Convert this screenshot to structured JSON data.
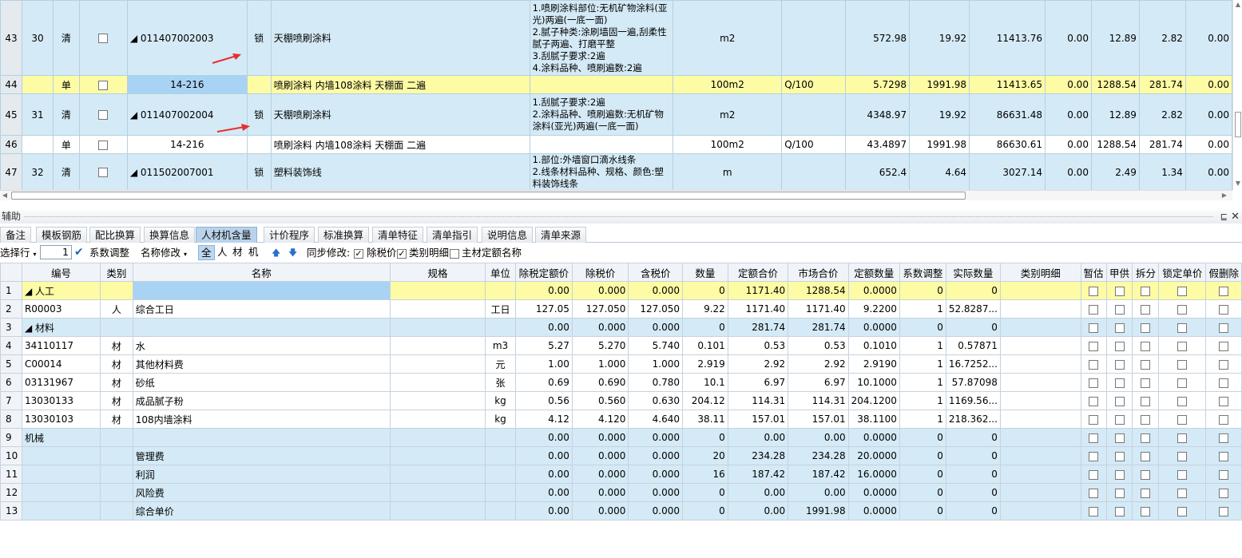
{
  "top_grid": {
    "rows": [
      {
        "rownum": "43",
        "seq": "30",
        "type": "清",
        "code": "◢ 011407002003",
        "lock": "锁",
        "name": "天棚喷刷涂料",
        "desc": "1.喷刷涂料部位:无机矿物涂料(亚光)两遍(一底一面)\n2.腻子种类:涂刷墙固一遍,刮柔性腻子两遍、打磨平整\n3.刮腻子要求:2遍\n4.涂料品种、喷刷遍数:2遍",
        "unit": "m2",
        "expr": "",
        "qty": "572.98",
        "price": "19.92",
        "total": "11413.76",
        "c1": "0.00",
        "c2": "12.89",
        "c3": "2.82",
        "c4": "0.00"
      },
      {
        "rownum": "44",
        "seq": "",
        "type": "单",
        "code": "14-216",
        "lock": "",
        "name": "喷刷涂料 内墙108涂料 天棚面 二遍",
        "desc": "",
        "unit": "100m2",
        "expr": "Q/100",
        "qty": "5.7298",
        "price": "1991.98",
        "total": "11413.65",
        "c1": "0.00",
        "c2": "1288.54",
        "c3": "281.74",
        "c4": "0.00"
      },
      {
        "rownum": "45",
        "seq": "31",
        "type": "清",
        "code": "◢ 011407002004",
        "lock": "锁",
        "name": "天棚喷刷涂料",
        "desc": "1.刮腻子要求:2遍\n2.涂料品种、喷刷遍数:无机矿物涂料(亚光)两遍(一底一面)",
        "unit": "m2",
        "expr": "",
        "qty": "4348.97",
        "price": "19.92",
        "total": "86631.48",
        "c1": "0.00",
        "c2": "12.89",
        "c3": "2.82",
        "c4": "0.00"
      },
      {
        "rownum": "46",
        "seq": "",
        "type": "单",
        "code": "14-216",
        "lock": "",
        "name": "喷刷涂料 内墙108涂料 天棚面 二遍",
        "desc": "",
        "unit": "100m2",
        "expr": "Q/100",
        "qty": "43.4897",
        "price": "1991.98",
        "total": "86630.61",
        "c1": "0.00",
        "c2": "1288.54",
        "c3": "281.74",
        "c4": "0.00"
      },
      {
        "rownum": "47",
        "seq": "32",
        "type": "清",
        "code": "◢ 011502007001",
        "lock": "锁",
        "name": "塑料装饰线",
        "desc": "1.部位:外墙窗口滴水线条\n2.线条材料品种、规格、颜色:塑料装饰线条",
        "unit": "m",
        "expr": "",
        "qty": "652.4",
        "price": "4.64",
        "total": "3027.14",
        "c1": "0.00",
        "c2": "2.49",
        "c3": "1.34",
        "c4": "0.00"
      }
    ]
  },
  "panel": {
    "title": "辅助",
    "pin": "⊑",
    "close": "✕"
  },
  "tabs": [
    "备注",
    "模板钢筋",
    "配比换算",
    "换算信息",
    "人材机含量",
    "计价程序",
    "标准换算",
    "清单特征",
    "清单指引",
    "说明信息",
    "清单来源"
  ],
  "active_tab": "人材机含量",
  "toolbar": {
    "select_row": "选择行",
    "spin_value": "1",
    "coef_adjust": "系数调整",
    "name_edit": "名称修改",
    "filters": [
      "全",
      "人",
      "材",
      "机"
    ],
    "sync_label": "同步修改:",
    "opt1": "除税价",
    "opt2": "类别明细",
    "opt3": "主材定额名称"
  },
  "bottom_grid": {
    "headers": [
      "编号",
      "类别",
      "名称",
      "规格",
      "单位",
      "除税定额价",
      "除税价",
      "含税价",
      "数量",
      "定额合价",
      "市场合价",
      "定额数量",
      "系数调整",
      "实际数量",
      "类别明细",
      "暂估",
      "甲供",
      "拆分",
      "锁定单价",
      "假删除"
    ],
    "rows": [
      {
        "rn": "1",
        "code": "◢ 人工",
        "cat": "",
        "name": "",
        "spec": "",
        "unit": "",
        "v1": "0.00",
        "v2": "0.000",
        "v3": "0.000",
        "qty": "0",
        "t1": "1171.40",
        "t2": "1288.54",
        "dq": "0.0000",
        "coef": "0",
        "aq": "0"
      },
      {
        "rn": "2",
        "code": "R00003",
        "cat": "人",
        "name": "综合工日",
        "spec": "",
        "unit": "工日",
        "v1": "127.05",
        "v2": "127.050",
        "v3": "127.050",
        "qty": "9.22",
        "t1": "1171.40",
        "t2": "1171.40",
        "dq": "9.2200",
        "coef": "1",
        "aq": "52.8287..."
      },
      {
        "rn": "3",
        "code": "◢ 材料",
        "cat": "",
        "name": "",
        "spec": "",
        "unit": "",
        "v1": "0.00",
        "v2": "0.000",
        "v3": "0.000",
        "qty": "0",
        "t1": "281.74",
        "t2": "281.74",
        "dq": "0.0000",
        "coef": "0",
        "aq": "0"
      },
      {
        "rn": "4",
        "code": "34110117",
        "cat": "材",
        "name": "水",
        "spec": "",
        "unit": "m3",
        "v1": "5.27",
        "v2": "5.270",
        "v3": "5.740",
        "qty": "0.101",
        "t1": "0.53",
        "t2": "0.53",
        "dq": "0.1010",
        "coef": "1",
        "aq": "0.57871"
      },
      {
        "rn": "5",
        "code": "C00014",
        "cat": "材",
        "name": "其他材料费",
        "spec": "",
        "unit": "元",
        "v1": "1.00",
        "v2": "1.000",
        "v3": "1.000",
        "qty": "2.919",
        "t1": "2.92",
        "t2": "2.92",
        "dq": "2.9190",
        "coef": "1",
        "aq": "16.7252..."
      },
      {
        "rn": "6",
        "code": "03131967",
        "cat": "材",
        "name": "砂纸",
        "spec": "",
        "unit": "张",
        "v1": "0.69",
        "v2": "0.690",
        "v3": "0.780",
        "qty": "10.1",
        "t1": "6.97",
        "t2": "6.97",
        "dq": "10.1000",
        "coef": "1",
        "aq": "57.87098"
      },
      {
        "rn": "7",
        "code": "13030133",
        "cat": "材",
        "name": "成品腻子粉",
        "spec": "",
        "unit": "kg",
        "v1": "0.56",
        "v2": "0.560",
        "v3": "0.630",
        "qty": "204.12",
        "t1": "114.31",
        "t2": "114.31",
        "dq": "204.1200",
        "coef": "1",
        "aq": "1169.56..."
      },
      {
        "rn": "8",
        "code": "13030103",
        "cat": "材",
        "name": "108内墙涂料",
        "spec": "",
        "unit": "kg",
        "v1": "4.12",
        "v2": "4.120",
        "v3": "4.640",
        "qty": "38.11",
        "t1": "157.01",
        "t2": "157.01",
        "dq": "38.1100",
        "coef": "1",
        "aq": "218.362..."
      },
      {
        "rn": "9",
        "code": "机械",
        "cat": "",
        "name": "",
        "spec": "",
        "unit": "",
        "v1": "0.00",
        "v2": "0.000",
        "v3": "0.000",
        "qty": "0",
        "t1": "0.00",
        "t2": "0.00",
        "dq": "0.0000",
        "coef": "0",
        "aq": "0"
      },
      {
        "rn": "10",
        "code": "",
        "cat": "",
        "name": "管理费",
        "spec": "",
        "unit": "",
        "v1": "0.00",
        "v2": "0.000",
        "v3": "0.000",
        "qty": "20",
        "t1": "234.28",
        "t2": "234.28",
        "dq": "20.0000",
        "coef": "0",
        "aq": "0"
      },
      {
        "rn": "11",
        "code": "",
        "cat": "",
        "name": "利润",
        "spec": "",
        "unit": "",
        "v1": "0.00",
        "v2": "0.000",
        "v3": "0.000",
        "qty": "16",
        "t1": "187.42",
        "t2": "187.42",
        "dq": "16.0000",
        "coef": "0",
        "aq": "0"
      },
      {
        "rn": "12",
        "code": "",
        "cat": "",
        "name": "风险费",
        "spec": "",
        "unit": "",
        "v1": "0.00",
        "v2": "0.000",
        "v3": "0.000",
        "qty": "0",
        "t1": "0.00",
        "t2": "0.00",
        "dq": "0.0000",
        "coef": "0",
        "aq": "0"
      },
      {
        "rn": "13",
        "code": "",
        "cat": "",
        "name": "综合单价",
        "spec": "",
        "unit": "",
        "v1": "0.00",
        "v2": "0.000",
        "v3": "0.000",
        "qty": "0",
        "t1": "0.00",
        "t2": "1991.98",
        "dq": "0.0000",
        "coef": "0",
        "aq": "0"
      }
    ]
  },
  "colors": {
    "row_blue": "#d4eaf6",
    "row_yellow": "#fdfba4",
    "selected": "#a9d3f4",
    "arrow": "#e53030"
  }
}
